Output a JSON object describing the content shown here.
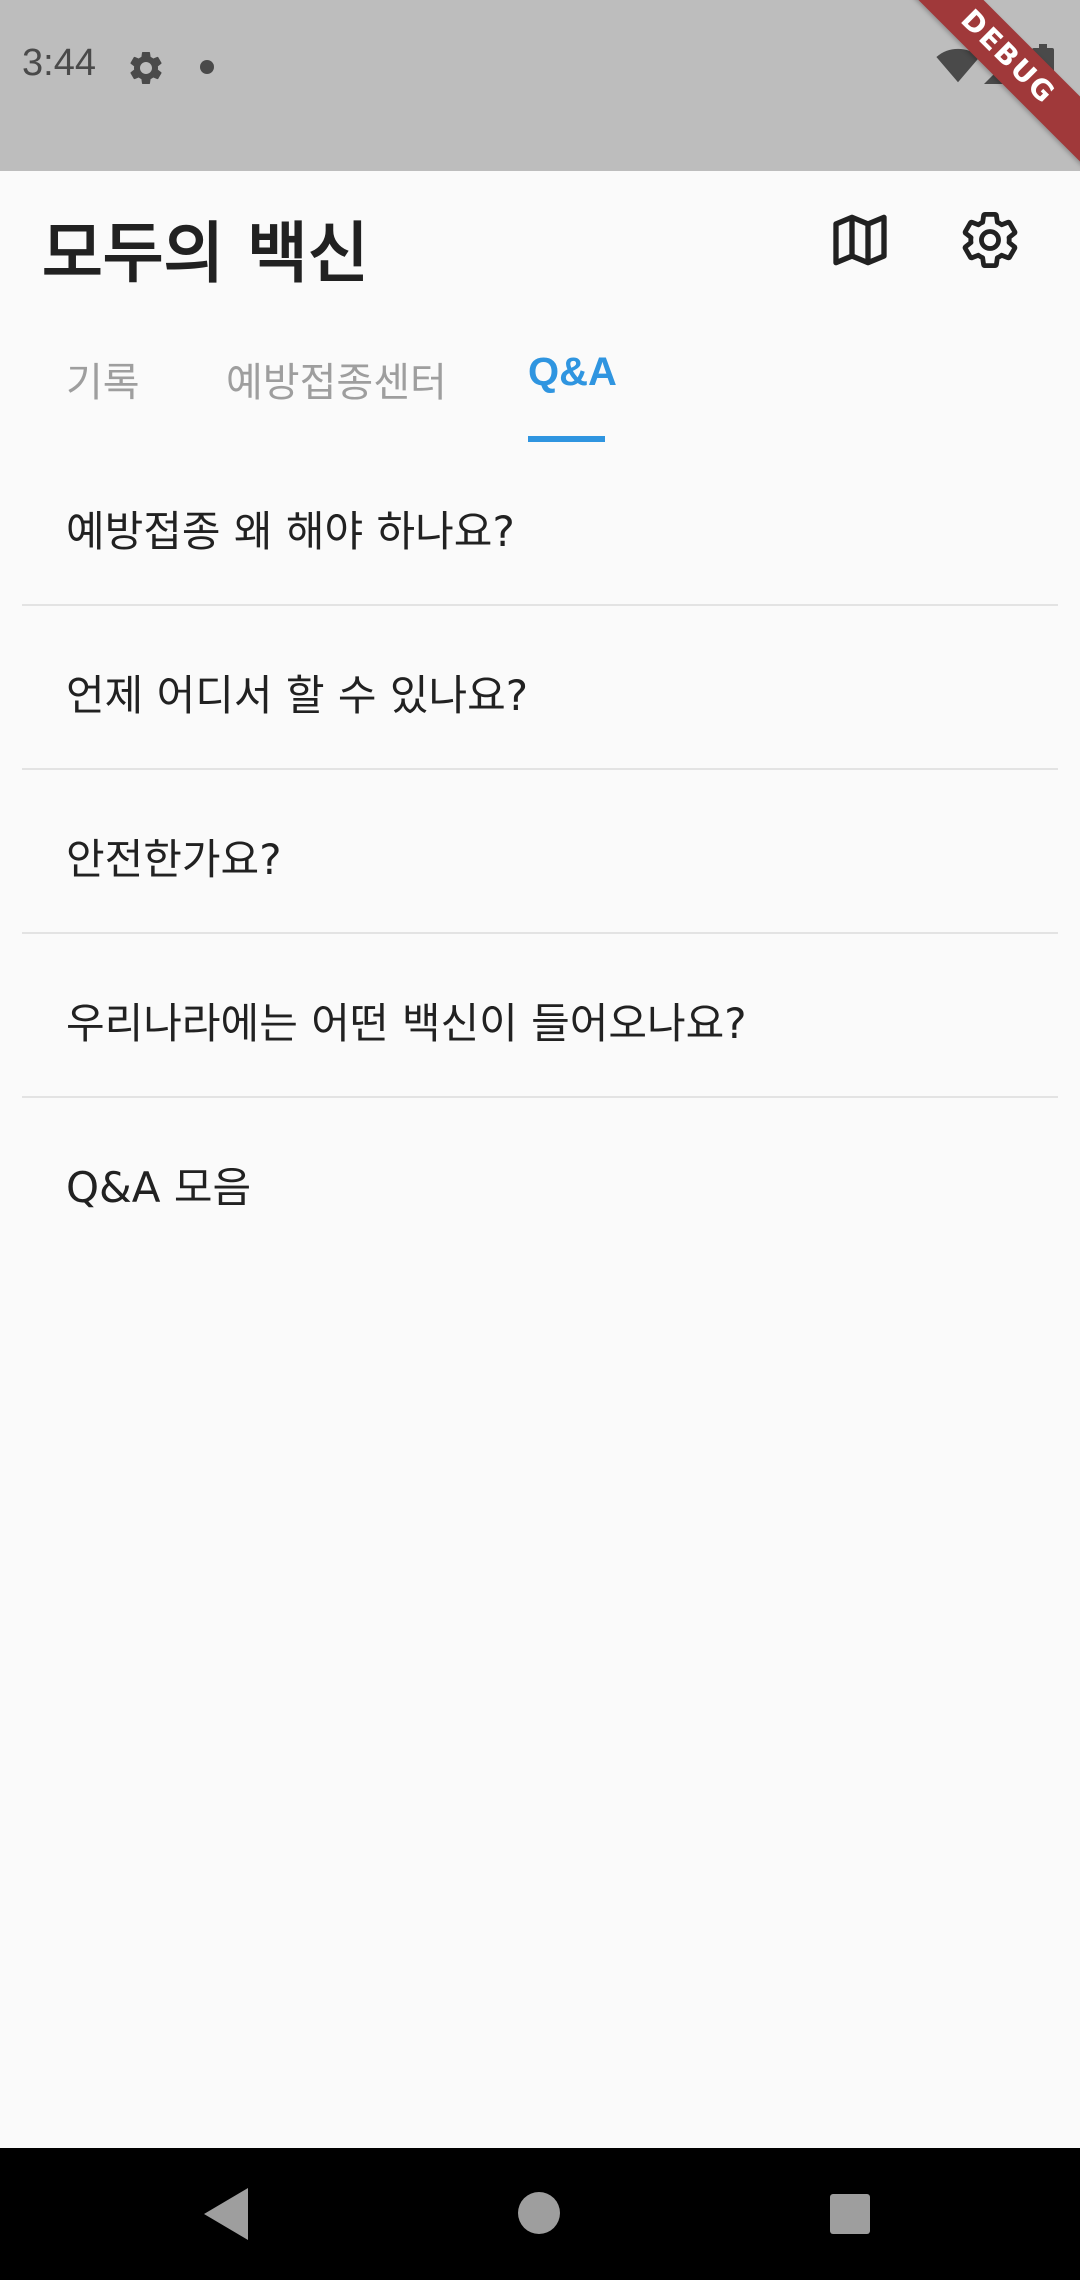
{
  "status_bar": {
    "time": "3:44",
    "icons": [
      "settings-icon",
      "notification-dot-icon",
      "wifi-icon",
      "signal-icon",
      "battery-icon"
    ],
    "debug_banner": "DEBUG"
  },
  "app_bar": {
    "title": "모두의 백신",
    "actions": [
      "map-icon",
      "settings-icon"
    ]
  },
  "tabs": [
    {
      "label": "기록",
      "selected": false
    },
    {
      "label": "예방접종센터",
      "selected": false
    },
    {
      "label": "Q&A",
      "selected": true
    }
  ],
  "qa_items": [
    {
      "label": "예방접종 왜 해야 하나요?"
    },
    {
      "label": "언제 어디서 할 수 있나요?"
    },
    {
      "label": "안전한가요?"
    },
    {
      "label": "우리나라에는 어떤 백신이 들어오나요?"
    },
    {
      "label": "Q&A 모음"
    }
  ],
  "nav_bar": {
    "buttons": [
      "back-icon",
      "home-icon",
      "recents-icon"
    ]
  },
  "colors": {
    "accent": "#2f95e0",
    "status_bar_bg": "#bdbdbd",
    "background": "#fafafa",
    "debug_banner": "#a0393a"
  }
}
